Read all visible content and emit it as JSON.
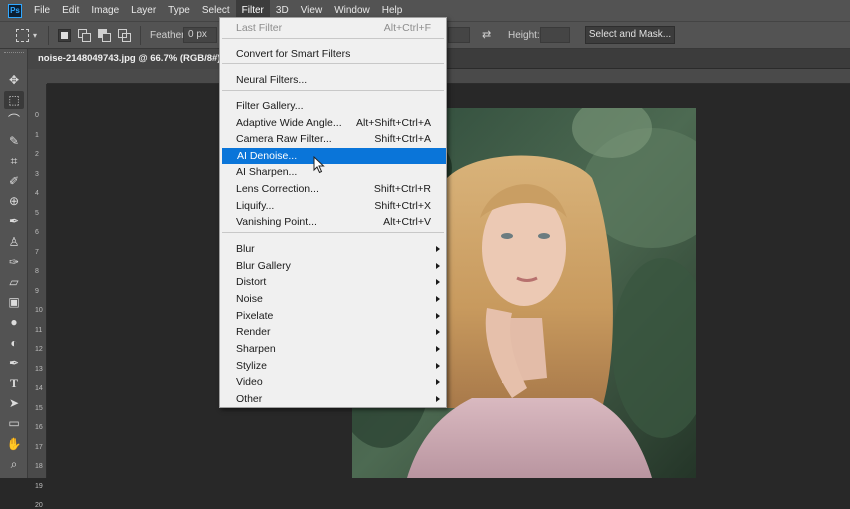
{
  "app": {
    "logo_text": "Ps"
  },
  "menubar": {
    "items": [
      "File",
      "Edit",
      "Image",
      "Layer",
      "Type",
      "Select",
      "Filter",
      "3D",
      "View",
      "Window",
      "Help"
    ],
    "active_index": 6
  },
  "options": {
    "feather_label": "Feather:",
    "feather_value": "0 px",
    "height_label": "Height:",
    "select_and_mask": "Select and Mask..."
  },
  "document": {
    "tab_title": "noise-2148049743.jpg @ 66.7% (RGB/8#)"
  },
  "ruler": {
    "left_labels": [
      "0",
      "1",
      "2",
      "3",
      "4",
      "5",
      "6",
      "7",
      "8",
      "9",
      "10",
      "11",
      "12",
      "13",
      "14",
      "15",
      "16",
      "17",
      "18",
      "19",
      "20"
    ]
  },
  "filter_menu": {
    "items": [
      {
        "label": "Last Filter",
        "shortcut": "Alt+Ctrl+F",
        "disabled": true
      },
      {
        "sep": true
      },
      {
        "label": "Convert for Smart Filters"
      },
      {
        "sep": true
      },
      {
        "label": "Neural Filters..."
      },
      {
        "sep": true
      },
      {
        "label": "Filter Gallery..."
      },
      {
        "label": "Adaptive Wide Angle...",
        "shortcut": "Alt+Shift+Ctrl+A"
      },
      {
        "label": "Camera Raw Filter...",
        "shortcut": "Shift+Ctrl+A"
      },
      {
        "label": "AI Denoise...",
        "highlighted": true
      },
      {
        "label": "AI Sharpen..."
      },
      {
        "label": "Lens Correction...",
        "shortcut": "Shift+Ctrl+R"
      },
      {
        "label": "Liquify...",
        "shortcut": "Shift+Ctrl+X"
      },
      {
        "label": "Vanishing Point...",
        "shortcut": "Alt+Ctrl+V"
      },
      {
        "sep": true
      },
      {
        "label": "Blur",
        "submenu": true
      },
      {
        "label": "Blur Gallery",
        "submenu": true
      },
      {
        "label": "Distort",
        "submenu": true
      },
      {
        "label": "Noise",
        "submenu": true
      },
      {
        "label": "Pixelate",
        "submenu": true
      },
      {
        "label": "Render",
        "submenu": true
      },
      {
        "label": "Sharpen",
        "submenu": true
      },
      {
        "label": "Stylize",
        "submenu": true
      },
      {
        "label": "Video",
        "submenu": true
      },
      {
        "label": "Other",
        "submenu": true
      }
    ]
  },
  "toolbar": {
    "tools": [
      "move-icon",
      "marquee-icon",
      "lasso-icon",
      "quick-select-icon",
      "crop-icon",
      "eyedropper-icon",
      "healing-icon",
      "brush-icon",
      "stamp-icon",
      "history-brush-icon",
      "eraser-icon",
      "gradient-icon",
      "blur-icon",
      "dodge-icon",
      "pen-icon",
      "type-icon",
      "path-select-icon",
      "shape-icon",
      "hand-icon",
      "zoom-icon"
    ],
    "selected_index": 1
  },
  "colors": {
    "menu_highlight": "#0a75d9",
    "ui_dark": "#535353",
    "canvas_bg": "#282828"
  }
}
